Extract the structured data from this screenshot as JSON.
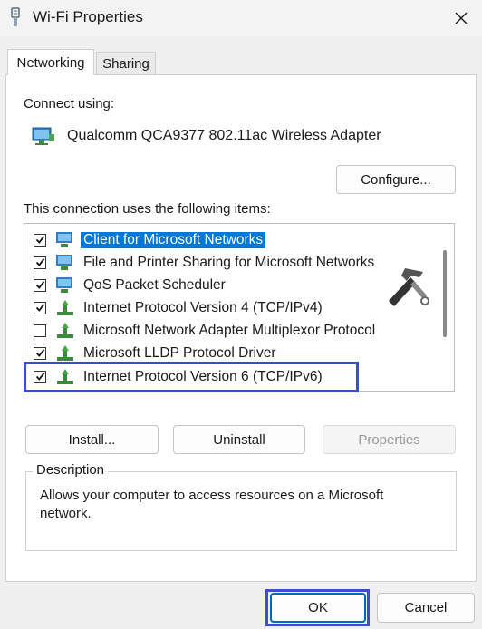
{
  "window": {
    "title": "Wi-Fi Properties",
    "title_icon": "network-adapter-icon",
    "close_icon": "close-icon"
  },
  "tabs": [
    {
      "label": "Networking",
      "selected": true
    },
    {
      "label": "Sharing",
      "selected": false
    }
  ],
  "connect_using": {
    "label": "Connect using:",
    "adapter": "Qualcomm QCA9377 802.11ac Wireless Adapter",
    "adapter_icon": "network-adapter-icon"
  },
  "buttons": {
    "configure": "Configure...",
    "install": "Install...",
    "uninstall": "Uninstall",
    "properties": "Properties",
    "ok": "OK",
    "cancel": "Cancel"
  },
  "items_label": "This connection uses the following items:",
  "items": [
    {
      "label": "Client for Microsoft Networks",
      "checked": true,
      "icon": "network-client-icon",
      "selected": true
    },
    {
      "label": "File and Printer Sharing for Microsoft Networks",
      "checked": true,
      "icon": "network-client-icon",
      "selected": false
    },
    {
      "label": "QoS Packet Scheduler",
      "checked": true,
      "icon": "network-client-icon",
      "selected": false
    },
    {
      "label": "Internet Protocol Version 4 (TCP/IPv4)",
      "checked": true,
      "icon": "protocol-icon",
      "selected": false
    },
    {
      "label": "Microsoft Network Adapter Multiplexor Protocol",
      "checked": false,
      "icon": "protocol-icon",
      "selected": false
    },
    {
      "label": "Microsoft LLDP Protocol Driver",
      "checked": true,
      "icon": "protocol-icon",
      "selected": false
    },
    {
      "label": "Internet Protocol Version 6 (TCP/IPv6)",
      "checked": true,
      "icon": "protocol-icon",
      "selected": false
    }
  ],
  "description": {
    "legend": "Description",
    "text": "Allows your computer to access resources on a Microsoft network."
  },
  "colors": {
    "highlight_box": "#3c4fc4",
    "selection": "#0078d7",
    "accent": "#0067c0"
  },
  "overlay_icon": "wrench-hammer-tools-icon"
}
